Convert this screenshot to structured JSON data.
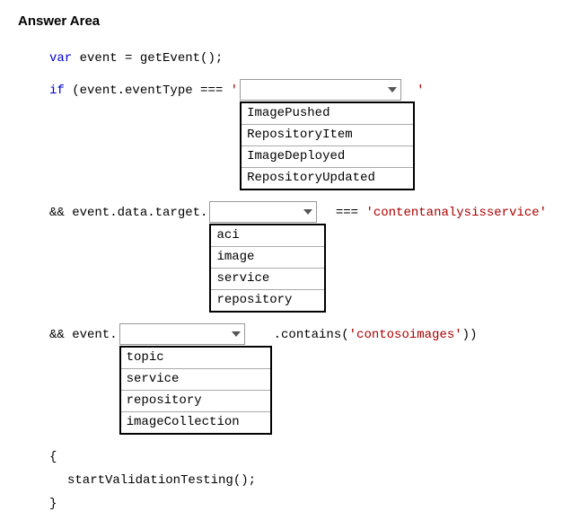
{
  "title": "Answer Area",
  "code": {
    "line1_var": "var",
    "line1_rest": " event = getEvent();",
    "line2_if": "if",
    "line2_cond_pre": " (event.eventType === ",
    "quote": "'",
    "line3_pre": "&& event.data.target.",
    "line3_eq": " === ",
    "line3_str": "'contentanalysisservice'",
    "line4_pre": "&& event.",
    "line4_mid": ".contains(",
    "line4_str": "'contosoimages'",
    "line4_end": "))",
    "brace_open": "{",
    "call": "startValidationTesting();",
    "brace_close": "}"
  },
  "dropdown1": {
    "selected": "",
    "options": [
      "ImagePushed",
      "RepositoryItem",
      "ImageDeployed",
      "RepositoryUpdated"
    ]
  },
  "dropdown2": {
    "selected": "",
    "options": [
      "aci",
      "image",
      "service",
      "repository"
    ]
  },
  "dropdown3": {
    "selected": "",
    "options": [
      "topic",
      "service",
      "repository",
      "imageCollection"
    ]
  }
}
